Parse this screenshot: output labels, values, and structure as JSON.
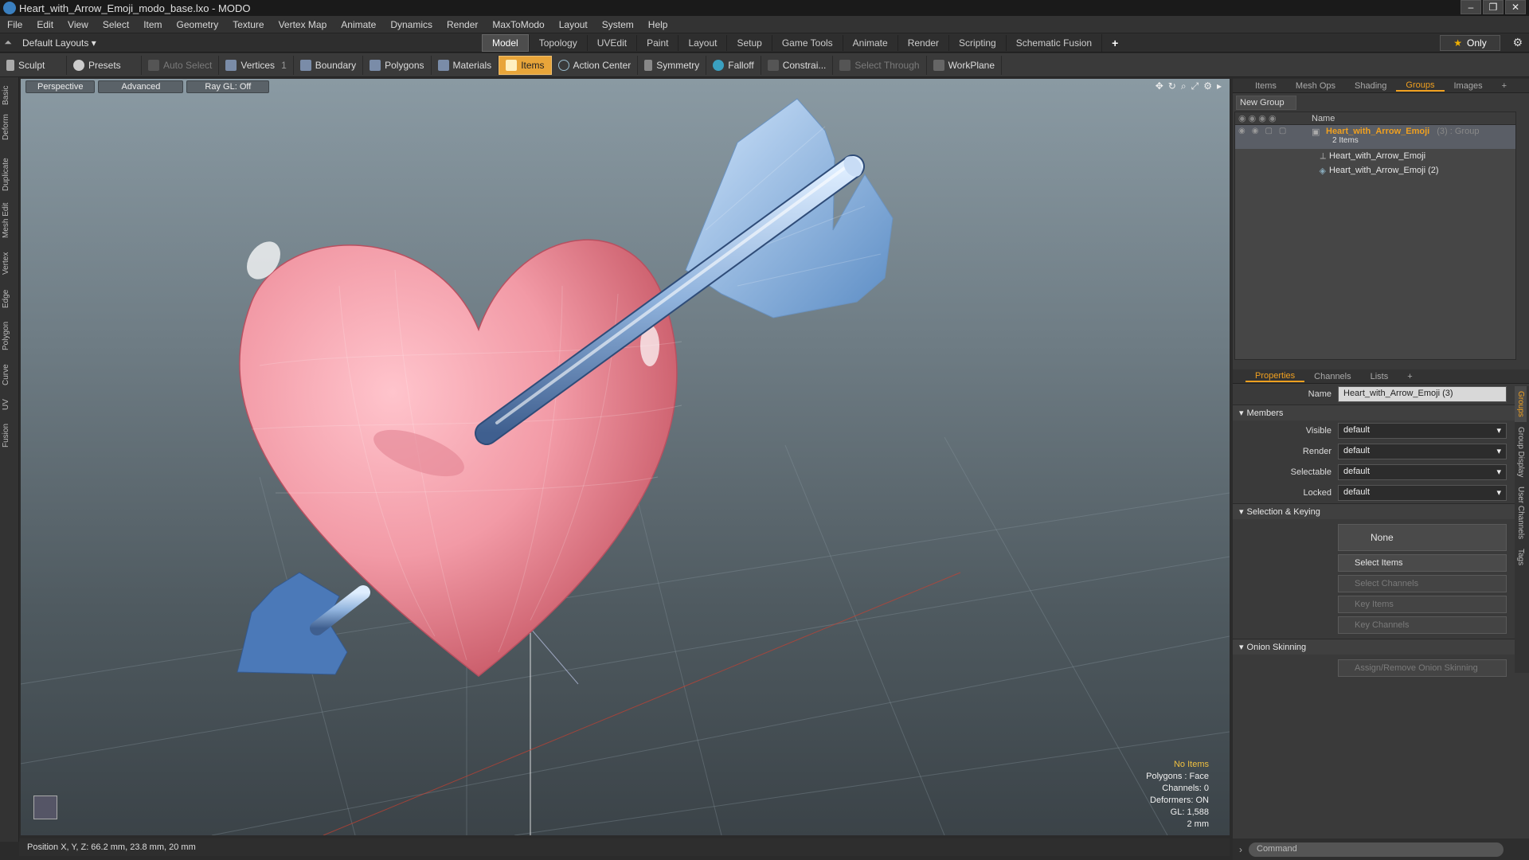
{
  "window": {
    "title": "Heart_with_Arrow_Emoji_modo_base.lxo - MODO"
  },
  "menu": [
    "File",
    "Edit",
    "View",
    "Select",
    "Item",
    "Geometry",
    "Texture",
    "Vertex Map",
    "Animate",
    "Dynamics",
    "Render",
    "MaxToModo",
    "Layout",
    "System",
    "Help"
  ],
  "layoutbar": {
    "layouts_label": "Default Layouts ▾",
    "tabs": [
      "Model",
      "Topology",
      "UVEdit",
      "Paint",
      "Layout",
      "Setup",
      "Game Tools",
      "Animate",
      "Render",
      "Scripting",
      "Schematic Fusion"
    ],
    "active_tab": "Model",
    "only_label": "Only"
  },
  "toolbar": {
    "sculpt": "Sculpt",
    "presets": "Presets",
    "auto_select": "Auto Select",
    "vertices": "Vertices",
    "vertices_count": "1",
    "boundary": "Boundary",
    "polygons": "Polygons",
    "materials": "Materials",
    "items": "Items",
    "action_center": "Action Center",
    "symmetry": "Symmetry",
    "falloff": "Falloff",
    "constraints": "Constrai...",
    "select_through": "Select Through",
    "workplane": "WorkPlane"
  },
  "leftstrip": [
    "Basic",
    "Deform",
    "Duplicate",
    "Mesh Edit",
    "Vertex",
    "Edge",
    "Polygon",
    "Curve",
    "UV",
    "Fusion"
  ],
  "viewport": {
    "view_mode": "Perspective",
    "shading": "Advanced",
    "raygl": "Ray GL: Off",
    "stats": {
      "items": "No Items",
      "polygons": "Polygons : Face",
      "channels": "Channels: 0",
      "deformers": "Deformers: ON",
      "gl": "GL: 1,588",
      "unit": "2 mm"
    }
  },
  "statusbar": {
    "position": "Position X, Y, Z:  66.2 mm, 23.8 mm, 20 mm"
  },
  "rightpanel": {
    "top_tabs": [
      "Items",
      "Mesh Ops",
      "Shading",
      "Groups",
      "Images",
      "+"
    ],
    "active_top_tab": "Groups",
    "new_group": "New Group",
    "col_name": "Name",
    "group": {
      "name": "Heart_with_Arrow_Emoji",
      "suffix": "(3) : Group",
      "count": "2 Items"
    },
    "children": [
      "Heart_with_Arrow_Emoji",
      "Heart_with_Arrow_Emoji (2)"
    ],
    "prop_tabs": [
      "Properties",
      "Channels",
      "Lists",
      "+"
    ],
    "active_prop_tab": "Properties",
    "name_label": "Name",
    "name_value": "Heart_with_Arrow_Emoji (3)",
    "members_label": "Members",
    "fields": [
      {
        "label": "Visible",
        "value": "default"
      },
      {
        "label": "Render",
        "value": "default"
      },
      {
        "label": "Selectable",
        "value": "default"
      },
      {
        "label": "Locked",
        "value": "default"
      }
    ],
    "sel_keying_label": "Selection & Keying",
    "none_label": "None",
    "select_items": "Select Items",
    "select_channels": "Select Channels",
    "key_items": "Key Items",
    "key_channels": "Key Channels",
    "onion_label": "Onion Skinning",
    "onion_btn": "Assign/Remove Onion Skinning",
    "side_tabs": [
      "Groups",
      "Group Display",
      "User Channels",
      "Tags"
    ]
  },
  "command": {
    "placeholder": "Command"
  },
  "colors": {
    "accent": "#f0a020",
    "heart": "#f08a96",
    "arrow": "#7aa8d8"
  }
}
